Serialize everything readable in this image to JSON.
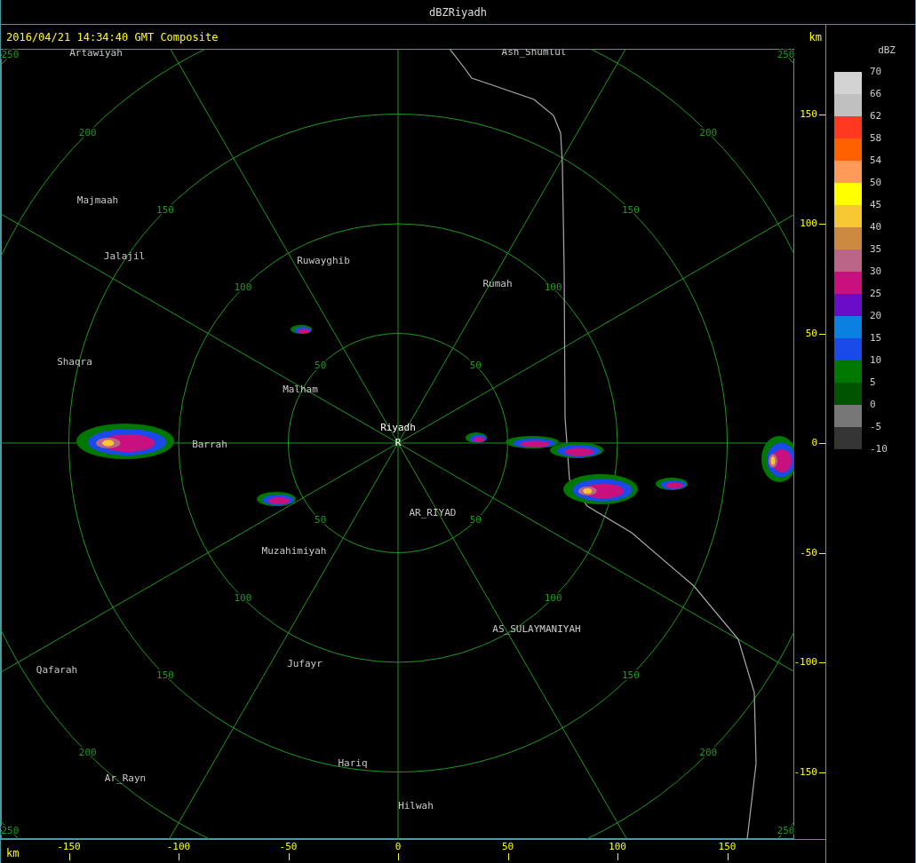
{
  "window": {
    "title": "dBZRiyadh"
  },
  "header": {
    "timestamp": "2016/04/21 14:34:40 GMT Composite",
    "unit": "km"
  },
  "map": {
    "radar_site": {
      "name": "Riyadh",
      "marker": "R"
    },
    "places": [
      "Artawiyah",
      "Ash_Shumlul",
      "Majmaah",
      "Jalajil",
      "Ruwayghib",
      "Rumah",
      "Shaqra",
      "Malham",
      "Barrah",
      "AR_RIYAD",
      "Muzahimiyah",
      "AS_SULAYMANIYAH",
      "Qafarah",
      "Jufayr",
      "Hariq",
      "Ar_Rayn",
      "Hilwah"
    ],
    "range_rings": [
      {
        "labels": [
          "50",
          "50",
          "50",
          "50"
        ]
      },
      {
        "labels": [
          "100",
          "100",
          "100",
          "100"
        ]
      },
      {
        "labels": [
          "150",
          "150",
          "150",
          "150"
        ]
      },
      {
        "labels": [
          "200",
          "200",
          "200",
          "200"
        ]
      },
      {
        "labels": [
          "250",
          "250",
          "250",
          "250"
        ]
      }
    ]
  },
  "y_axis": {
    "ticks": [
      "150",
      "100",
      "50",
      "0",
      "-50",
      "-100",
      "-150"
    ]
  },
  "x_axis": {
    "unit": "km",
    "ticks": [
      "-150",
      "-100",
      "-50",
      "0",
      "50",
      "100",
      "150"
    ]
  },
  "legend": {
    "title": "dBZ",
    "labels": [
      "70",
      "66",
      "62",
      "58",
      "54",
      "50",
      "45",
      "40",
      "35",
      "30",
      "25",
      "20",
      "15",
      "10",
      "5",
      "0",
      "-5",
      "-10"
    ],
    "bins": [
      {
        "color": "#d3d3d3"
      },
      {
        "color": "#c0c0c0"
      },
      {
        "color": "#ff3820"
      },
      {
        "color": "#ff6000"
      },
      {
        "color": "#ff9a5a"
      },
      {
        "color": "#ffff00"
      },
      {
        "color": "#f8c832"
      },
      {
        "color": "#cc8a40"
      },
      {
        "color": "#bb6688"
      },
      {
        "color": "#c8107f"
      },
      {
        "color": "#6a0dc8"
      },
      {
        "color": "#0a80e0"
      },
      {
        "color": "#1a4ae8"
      },
      {
        "color": "#007800"
      },
      {
        "color": "#005400"
      },
      {
        "color": "#777777"
      },
      {
        "color": "#353535"
      }
    ]
  }
}
